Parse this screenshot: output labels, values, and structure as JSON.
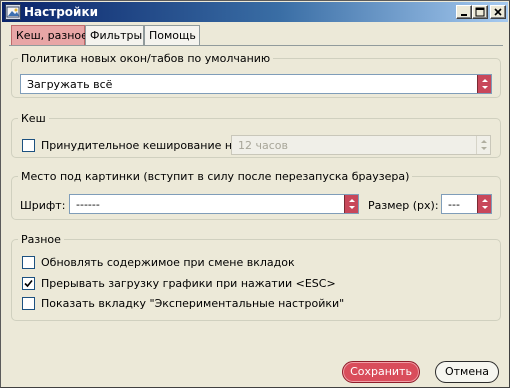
{
  "window": {
    "title": "Настройки"
  },
  "tabs": [
    {
      "label": "Кеш, разное",
      "active": true
    },
    {
      "label": "Фильтры",
      "active": false
    },
    {
      "label": "Помощь",
      "active": false
    }
  ],
  "policy_group": {
    "legend": "Политика новых окон/табов по умолчанию",
    "select_value": "Загружать всё"
  },
  "cache_group": {
    "legend": "Кеш",
    "force_cache_label": "Принудительное кеширование на:",
    "force_cache_checked": false,
    "duration_value": "12 часов",
    "duration_enabled": false
  },
  "images_group": {
    "legend": "Место под картинки (вступит в силу после перезапуска браузера)",
    "font_label": "Шрифт:",
    "font_value": "------",
    "size_label": "Размер (px):",
    "size_value": "---"
  },
  "misc_group": {
    "legend": "Разное",
    "options": [
      {
        "label": "Обновлять содержимое при смене вкладок",
        "checked": false
      },
      {
        "label": "Прерывать загрузку графики при нажатии <ESC>",
        "checked": true
      },
      {
        "label": "Показать вкладку \"Экспериментальные настройки\"",
        "checked": false
      }
    ]
  },
  "buttons": {
    "save": "Сохранить",
    "cancel": "Отмена"
  },
  "colors": {
    "accent": "#d94d5b",
    "active_tab": "#e8a6a6",
    "titlebar_start": "#0a246a"
  }
}
